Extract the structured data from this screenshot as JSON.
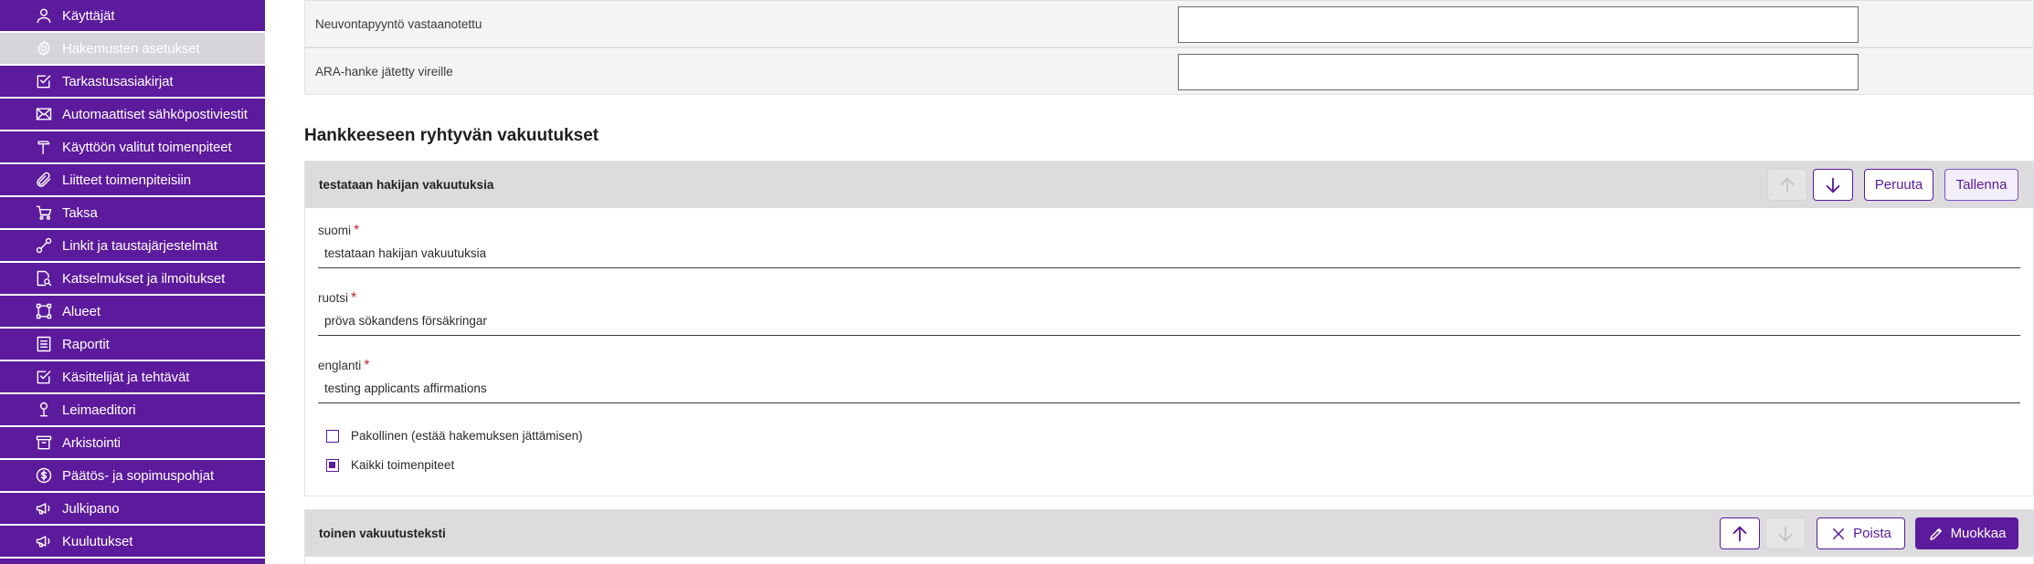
{
  "sidebar": {
    "items": [
      {
        "label": "Käyttäjät",
        "icon": "user-icon"
      },
      {
        "label": "Hakemusten asetukset",
        "icon": "gear-icon",
        "active": true
      },
      {
        "label": "Tarkastusasiakirjat",
        "icon": "checklist-icon"
      },
      {
        "label": "Automaattiset sähköpostiviestit",
        "icon": "envelope-icon"
      },
      {
        "label": "Käyttöön valitut toimenpiteet",
        "icon": "hammer-icon"
      },
      {
        "label": "Liitteet toimenpiteisiin",
        "icon": "paperclip-icon"
      },
      {
        "label": "Taksa",
        "icon": "cart-icon"
      },
      {
        "label": "Linkit ja taustajärjestelmät",
        "icon": "link-icon"
      },
      {
        "label": "Katselmukset ja ilmoitukset",
        "icon": "document-search-icon"
      },
      {
        "label": "Alueet",
        "icon": "area-icon"
      },
      {
        "label": "Raportit",
        "icon": "report-icon"
      },
      {
        "label": "Käsittelijät ja tehtävät",
        "icon": "task-icon"
      },
      {
        "label": "Leimaeditori",
        "icon": "stamp-icon"
      },
      {
        "label": "Arkistointi",
        "icon": "archive-icon"
      },
      {
        "label": "Päätös- ja sopimuspohjat",
        "icon": "coin-icon"
      },
      {
        "label": "Julkipano",
        "icon": "megaphone-icon"
      },
      {
        "label": "Kuulutukset",
        "icon": "megaphone-icon"
      }
    ]
  },
  "info_rows": [
    {
      "label": "Neuvontapyyntö vastaanotettu",
      "value": ""
    },
    {
      "label": "ARA-hanke jätetty vireille",
      "value": ""
    }
  ],
  "section": {
    "title": "Hankkeeseen ryhtyvän vakuutukset"
  },
  "card_edit": {
    "title": "testataan hakijan vakuutuksia",
    "cancel_label": "Peruuta",
    "save_label": "Tallenna",
    "required_mark": "*",
    "fields": [
      {
        "label": "suomi",
        "value": "testataan hakijan vakuutuksia"
      },
      {
        "label": "ruotsi",
        "value": "pröva sökandens försäkringar"
      },
      {
        "label": "englanti",
        "value": "testing applicants affirmations"
      }
    ],
    "checkboxes": [
      {
        "label": "Pakollinen (estää hakemuksen jättämisen)",
        "checked": false
      },
      {
        "label": "Kaikki toimenpiteet",
        "checked": true
      }
    ]
  },
  "card_view": {
    "title": "toinen vakuutusteksti",
    "delete_label": "Poista",
    "edit_label": "Muokkaa"
  },
  "colors": {
    "brand": "#5c1a9c",
    "active_item": "#d7d4da",
    "required": "#c0282e"
  }
}
